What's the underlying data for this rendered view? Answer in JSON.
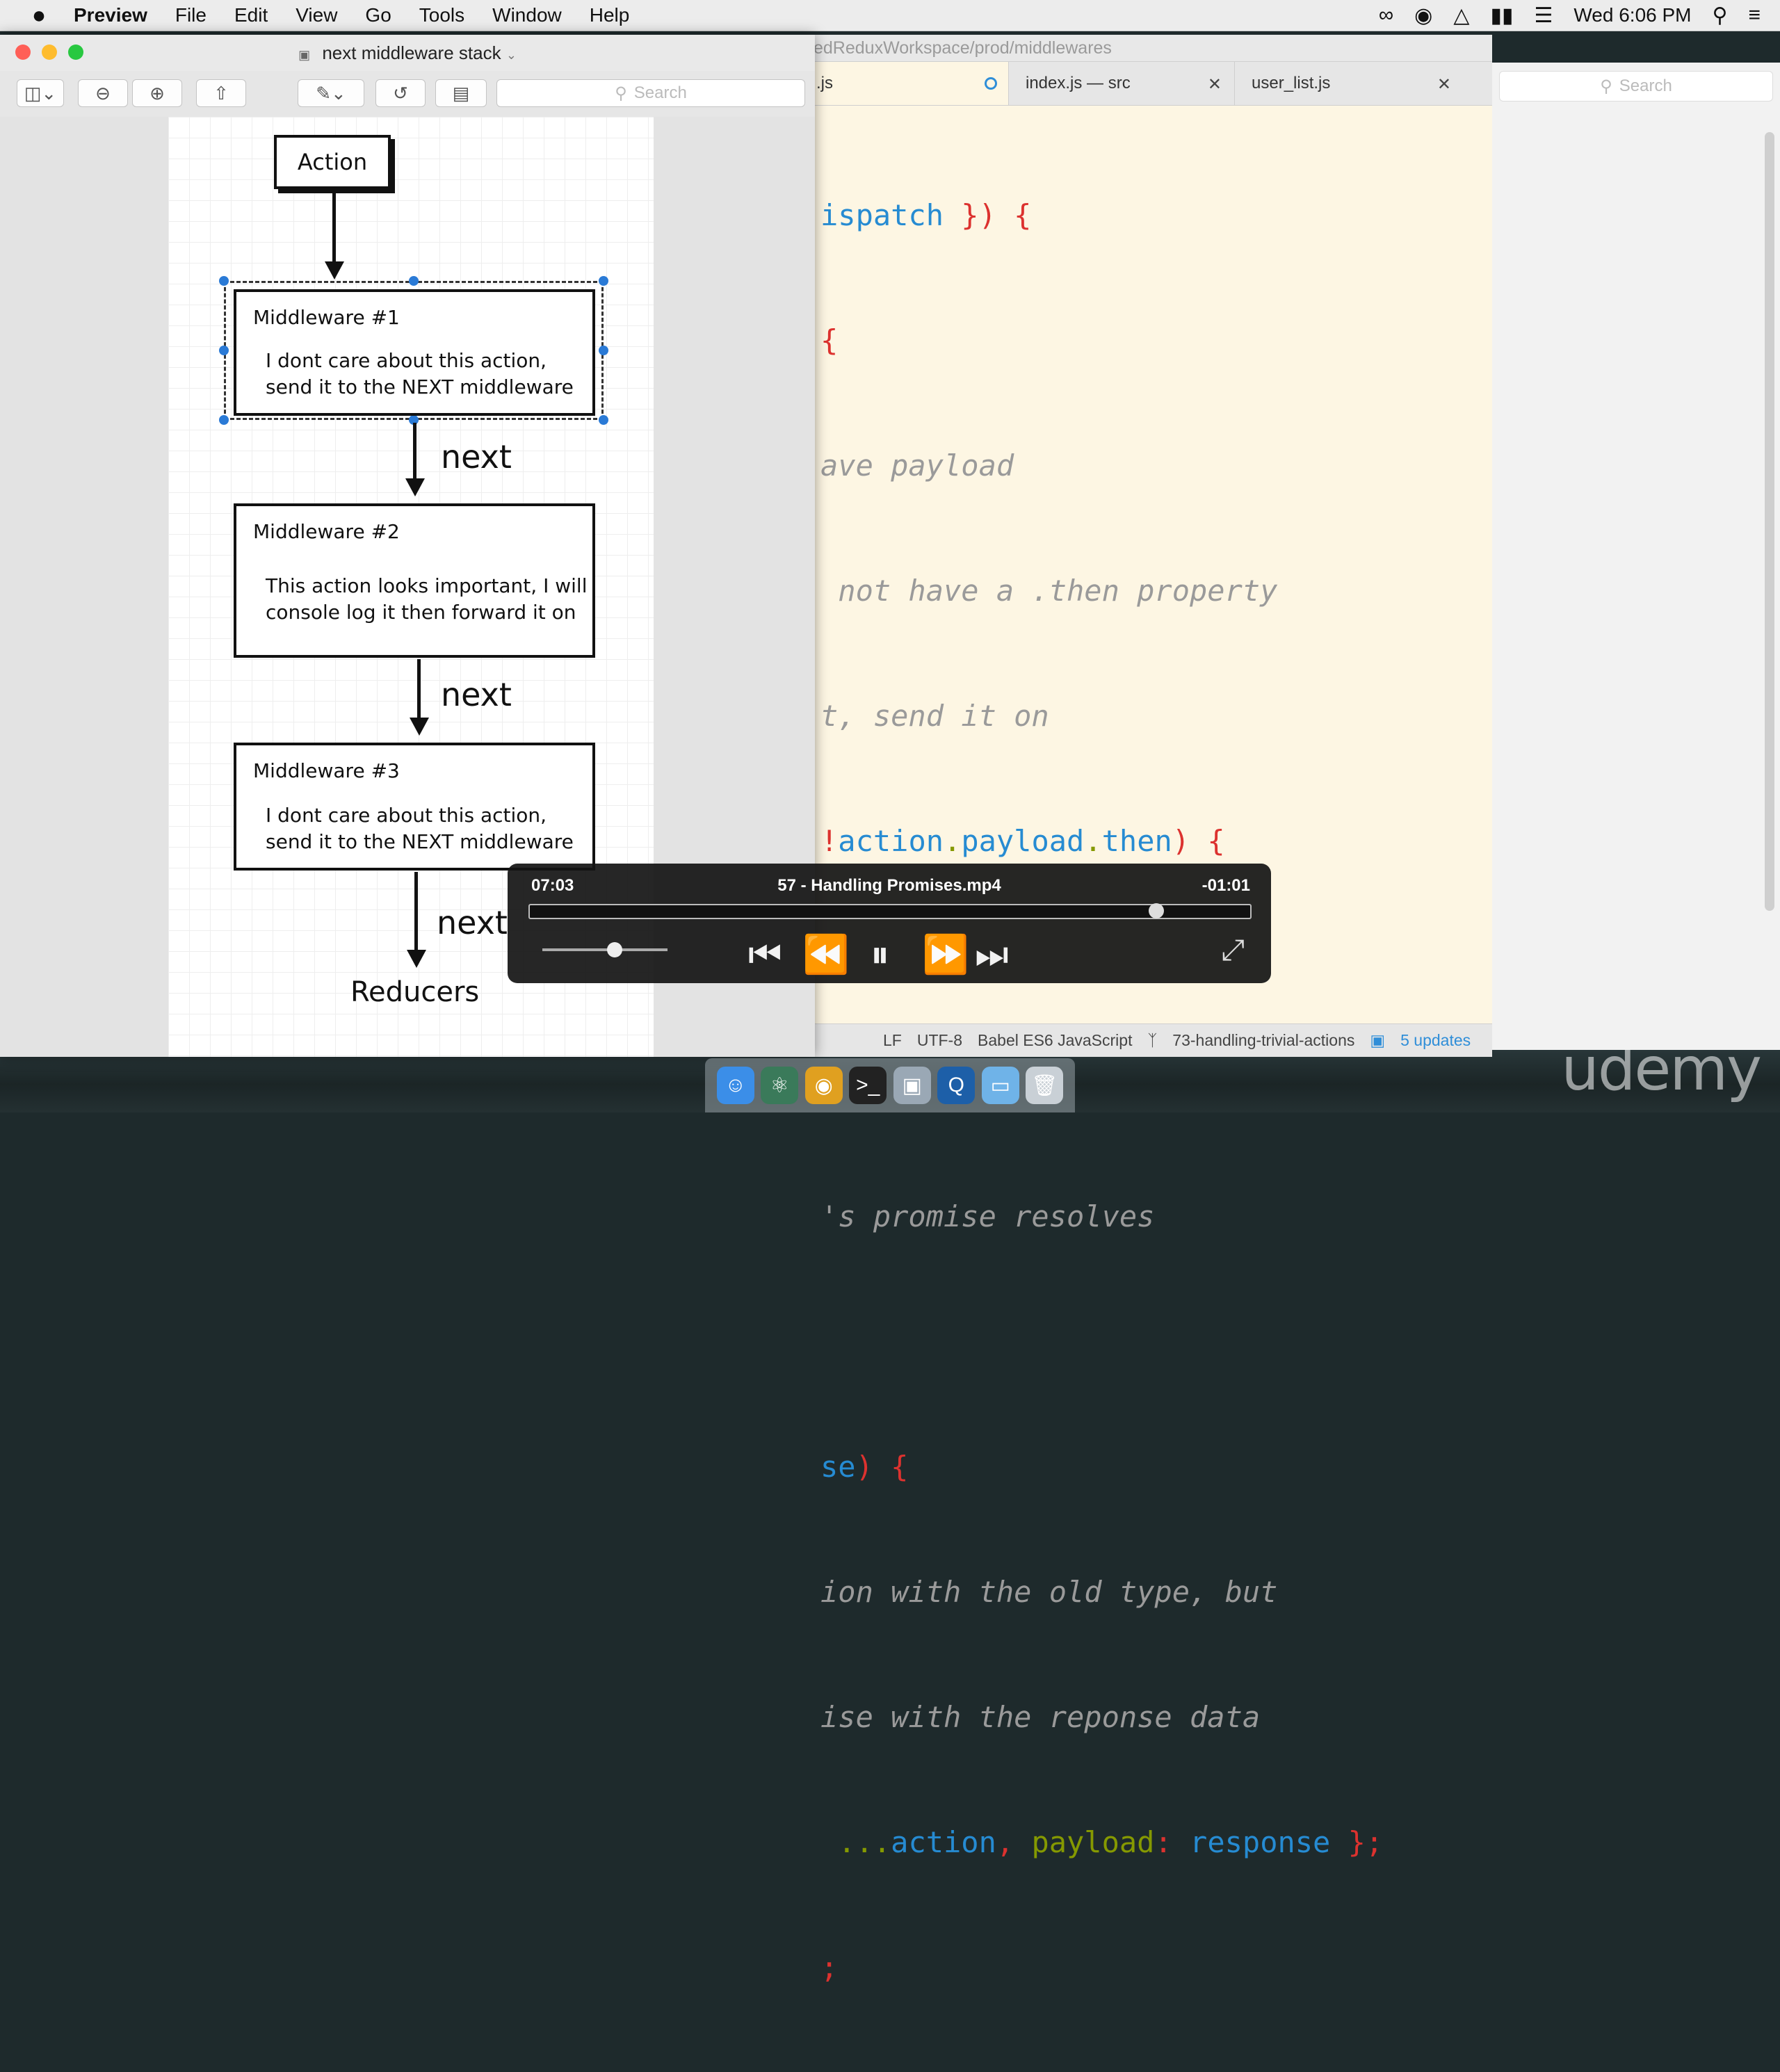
{
  "menubar": {
    "apple": "",
    "items": [
      "Preview",
      "File",
      "Edit",
      "View",
      "Go",
      "Tools",
      "Window",
      "Help"
    ],
    "clock": "Wed 6:06 PM",
    "icons": [
      "glasses-icon",
      "record-icon",
      "airplay-icon",
      "battery-icon",
      "wifi-icon",
      "spotlight-icon",
      "notification-center-icon"
    ]
  },
  "preview": {
    "window_title": "next middleware stack",
    "search_placeholder": "Search",
    "diagram": {
      "action": "Action",
      "m1_title": "Middleware #1",
      "m1_line1": "I dont care about this action,",
      "m1_line2": "send it to the NEXT middleware",
      "m2_title": "Middleware #2",
      "m2_line1": "This action looks important, I will",
      "m2_line2": "console log it then forward it on",
      "m3_title": "Middleware #3",
      "m3_line1": "I dont care about this action,",
      "m3_line2": "send it to the NEXT middleware",
      "next": "next",
      "reducers": "Reducers"
    }
  },
  "editor": {
    "path": "edReduxWorkspace/prod/middlewares",
    "tabs": [
      {
        "label": ".js"
      },
      {
        "label": "index.js — src"
      },
      {
        "label": "user_list.js"
      }
    ],
    "status": {
      "eol": "LF",
      "encoding": "UTF-8",
      "grammar": "Babel ES6 JavaScript",
      "branch": "73-handling-trivial-actions",
      "updates": "5 updates"
    }
  },
  "code": {
    "l1a": "ispatch",
    "l1b": " }) {",
    "l2": "{",
    "l3": "ave payload",
    "l4": " not have a .then property",
    "l5": "t, send it on",
    "l6a": "!",
    "l6b": "action",
    "l6c": ".",
    "l6d": "payload",
    "l6e": ".",
    "l6f": "then",
    "l6g": ") {",
    "l7": "'s promise resolves",
    "l8a": "se",
    "l8b": ") {",
    "l9": "ion with the old type, but",
    "l10": "ise with the reponse data",
    "l11a": " ...",
    "l11b": "action",
    "l11c": ", ",
    "l11d": "payload",
    "l11e": ": ",
    "l11f": "response",
    "l11g": " };",
    "l12": ";"
  },
  "rightpane": {
    "search_placeholder": "Search"
  },
  "video": {
    "elapsed": "07:03",
    "title": "57 - Handling Promises.mp4",
    "remaining": "-01:01",
    "progress": 0.87,
    "volume": 0.58
  },
  "watermark": "udemy"
}
